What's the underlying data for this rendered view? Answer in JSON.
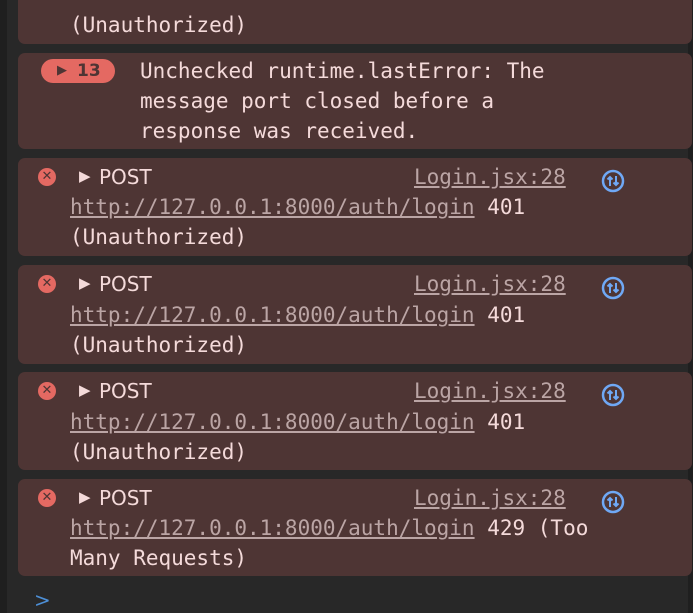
{
  "top_fragment": {
    "status_text": "(Unauthorized)"
  },
  "warning_group": {
    "count": "13",
    "lines": [
      "Unchecked runtime.lastError: The",
      "message port closed before a",
      "response was received."
    ]
  },
  "errors": [
    {
      "method": "POST",
      "source": "Login.jsx:28",
      "url": "http://127.0.0.1:8000/auth/login",
      "status_suffix": " 401",
      "status_line2": "(Unauthorized)"
    },
    {
      "method": "POST",
      "source": "Login.jsx:28",
      "url": "http://127.0.0.1:8000/auth/login",
      "status_suffix": " 401",
      "status_line2": "(Unauthorized)"
    },
    {
      "method": "POST",
      "source": "Login.jsx:28",
      "url": "http://127.0.0.1:8000/auth/login",
      "status_suffix": " 401",
      "status_line2": "(Unauthorized)"
    },
    {
      "method": "POST",
      "source": "Login.jsx:28",
      "url": "http://127.0.0.1:8000/auth/login",
      "status_suffix": " 429 (Too",
      "status_line2": "Many Requests)"
    }
  ],
  "icons": {
    "error": "error-circle-icon",
    "expand": "expand-triangle-icon",
    "network": "network-request-icon",
    "prompt": "console-prompt-chevron-icon"
  },
  "prompt_symbol": ">",
  "colors": {
    "panel_background": "#282828",
    "error_message_background": "#4e3534",
    "error_text": "#f4dada",
    "error_accent": "#e46962",
    "link_text": "#bba5a5",
    "network_icon": "#6fa8f5",
    "prompt": "#4d8fd6"
  }
}
